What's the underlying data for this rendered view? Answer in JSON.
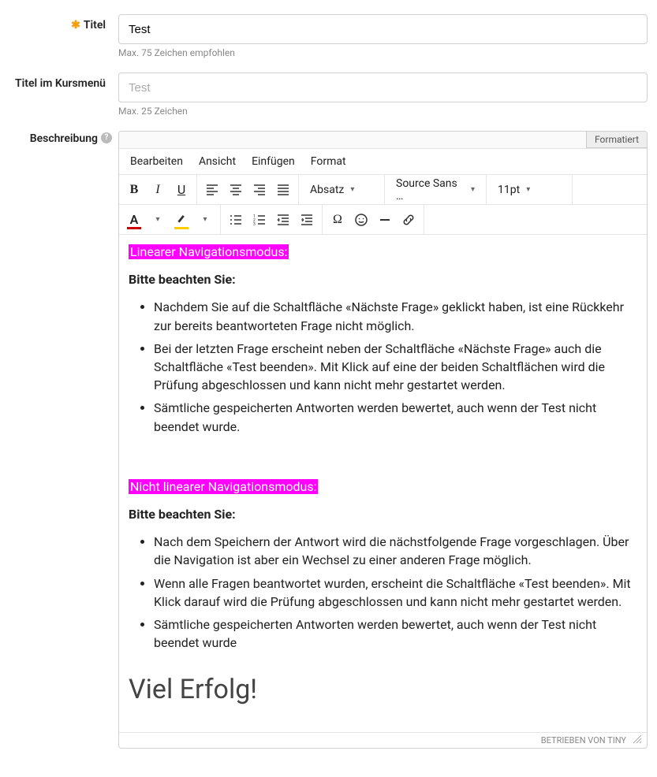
{
  "fields": {
    "titel": {
      "label": "Titel",
      "value": "Test",
      "help": "Max. 75 Zeichen empfohlen",
      "required": true
    },
    "kursmenue": {
      "label": "Titel im Kursmenü",
      "placeholder": "Test",
      "value": "",
      "help": "Max. 25 Zeichen"
    },
    "beschreibung": {
      "label": "Beschreibung"
    }
  },
  "editor": {
    "mode_label": "Formatiert",
    "menu": {
      "edit": "Bearbeiten",
      "view": "Ansicht",
      "insert": "Einfügen",
      "format": "Format"
    },
    "block_format": "Absatz",
    "font_family": "Source Sans …",
    "font_size": "11pt",
    "text_color": "#cc0000",
    "highlight_color": "#ffcc00",
    "footer": "BETRIEBEN VON TINY"
  },
  "content": {
    "h1": "Linearer Navigationsmodus:",
    "note1": "Bitte beachten Sie:",
    "list1": [
      "Nachdem Sie auf die Schaltfläche «Nächste Frage» geklickt haben,  ist eine Rückkehr zur bereits beantworteten Frage nicht möglich.",
      "Bei der letzten Frage erscheint neben der Schaltfläche «Nächste Frage» auch die Schaltfläche «Test beenden». Mit Klick auf eine der beiden Schaltflächen wird die Prüfung abgeschlossen und kann nicht mehr gestartet werden.",
      "Sämtliche gespeicherten Antworten werden bewertet, auch wenn der Test nicht beendet wurde."
    ],
    "h2": "Nicht linearer Navigationsmodus:",
    "note2": "Bitte beachten Sie:",
    "list2": [
      "Nach dem Speichern der Antwort wird die nächstfolgende Frage vorgeschlagen. Über die Navigation ist aber ein Wechsel zu einer anderen Frage möglich.",
      "Wenn alle Fragen beantwortet  wurden, erscheint die Schaltfläche «Test beenden». Mit Klick darauf wird die Prüfung abgeschlossen und kann nicht mehr gestartet werden.",
      "Sämtliche gespeicherten Antworten werden bewertet, auch wenn der Test nicht beendet wurde"
    ],
    "success": "Viel Erfolg!"
  }
}
